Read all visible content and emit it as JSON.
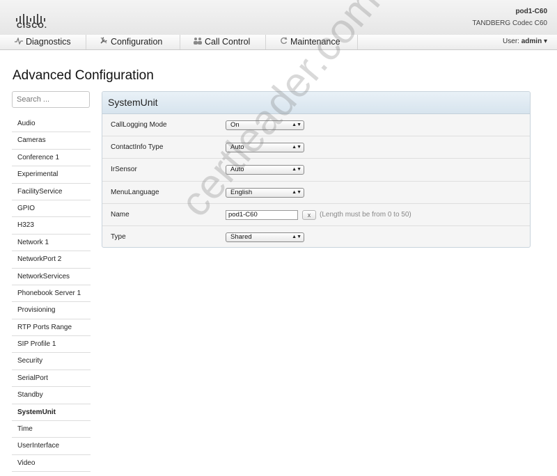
{
  "header": {
    "logo_text": "CISCO.",
    "device_name": "pod1-C60",
    "device_model": "TANDBERG Codec C60"
  },
  "nav": {
    "tabs": [
      {
        "label": "Diagnostics",
        "icon": "pulse-icon"
      },
      {
        "label": "Configuration",
        "icon": "wrench-icon"
      },
      {
        "label": "Call Control",
        "icon": "people-icon"
      },
      {
        "label": "Maintenance",
        "icon": "refresh-icon"
      }
    ],
    "user_prefix": "User:",
    "user_name": "admin",
    "user_caret": "▾"
  },
  "page": {
    "title": "Advanced Configuration"
  },
  "sidebar": {
    "search_placeholder": "Search ...",
    "items": [
      "Audio",
      "Cameras",
      "Conference 1",
      "Experimental",
      "FacilityService",
      "GPIO",
      "H323",
      "Network 1",
      "NetworkPort 2",
      "NetworkServices",
      "Phonebook Server 1",
      "Provisioning",
      "RTP Ports Range",
      "SIP Profile 1",
      "Security",
      "SerialPort",
      "Standby",
      "SystemUnit",
      "Time",
      "UserInterface",
      "Video"
    ],
    "active_item": "SystemUnit"
  },
  "panel": {
    "title": "SystemUnit",
    "rows": [
      {
        "label": "CallLogging Mode",
        "type": "select",
        "value": "On"
      },
      {
        "label": "ContactInfo Type",
        "type": "select",
        "value": "Auto"
      },
      {
        "label": "IrSensor",
        "type": "select",
        "value": "Auto"
      },
      {
        "label": "MenuLanguage",
        "type": "select",
        "value": "English"
      },
      {
        "label": "Name",
        "type": "text",
        "value": "pod1-C60",
        "clear_label": "x",
        "hint": "(Length must be from 0 to 50)"
      },
      {
        "label": "Type",
        "type": "select",
        "value": "Shared"
      }
    ]
  },
  "watermark": "certleader.com"
}
